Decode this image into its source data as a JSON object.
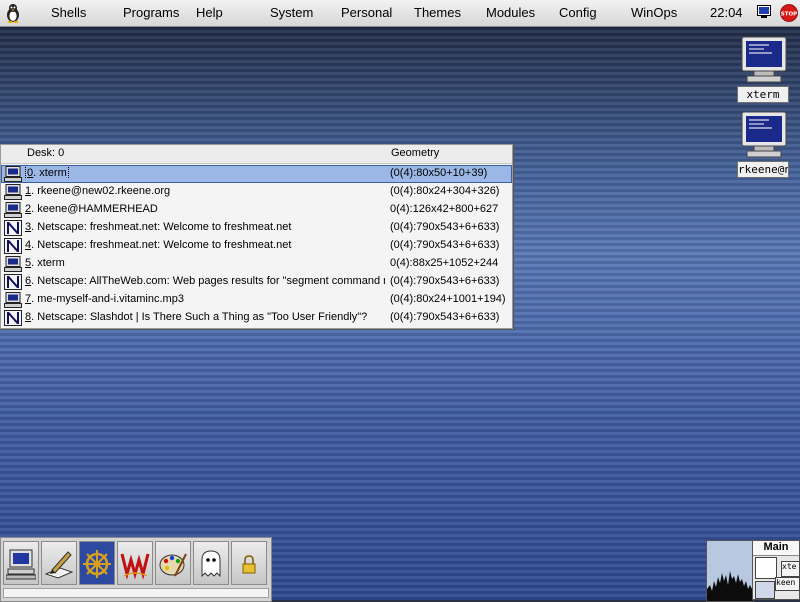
{
  "menubar": {
    "items": [
      "Shells",
      "Programs",
      "Help",
      "System",
      "Personal",
      "Themes",
      "Modules",
      "Config",
      "WinOps"
    ],
    "clock": "22:04",
    "stop_label": "STOP"
  },
  "desktop_icons": [
    {
      "label": "xterm",
      "icon": "monitor-icon"
    },
    {
      "label": "rkeene@n",
      "icon": "monitor-icon"
    }
  ],
  "window_list": {
    "header_desk": "Desk: 0",
    "header_geometry": "Geometry",
    "rows": [
      {
        "num": "0",
        "title": "xterm",
        "geometry": "(0(4):80x50+10+39)",
        "icon": "terminal-icon",
        "selected": true
      },
      {
        "num": "1",
        "title": "rkeene@new02.rkeene.org",
        "geometry": "(0(4):80x24+304+326)",
        "icon": "terminal-icon"
      },
      {
        "num": "2",
        "title": "keene@HAMMERHEAD",
        "geometry": "0(4):126x42+800+627",
        "icon": "terminal-icon"
      },
      {
        "num": "3",
        "title": "Netscape: freshmeat.net: Welcome to freshmeat.net",
        "geometry": "(0(4):790x543+6+633)",
        "icon": "netscape-icon"
      },
      {
        "num": "4",
        "title": "Netscape: freshmeat.net: Welcome to freshmeat.net",
        "geometry": "(0(4):790x543+6+633)",
        "icon": "netscape-icon"
      },
      {
        "num": "5",
        "title": "xterm",
        "geometry": "0(4):88x25+1052+244",
        "icon": "terminal-icon"
      },
      {
        "num": "6",
        "title": "Netscape: AllTheWeb.com: Web pages results for \"segment command maps\"",
        "geometry": "(0(4):790x543+6+633)",
        "icon": "netscape-icon"
      },
      {
        "num": "7",
        "title": "me-myself-and-i.vitaminc.mp3",
        "geometry": "(0(4):80x24+1001+194)",
        "icon": "terminal-icon"
      },
      {
        "num": "8",
        "title": "Netscape: Slashdot | Is There Such a Thing as \"Too User Friendly\"?",
        "geometry": "(0(4):790x543+6+633)",
        "icon": "netscape-icon"
      }
    ]
  },
  "dock": {
    "buttons": [
      "computer-icon",
      "editor-pen-icon",
      "ship-wheel-icon",
      "wine-w-icon",
      "paint-palette-icon",
      "ghost-icon",
      "lock-icon"
    ]
  },
  "pager": {
    "title": "Main",
    "windows": [
      "xte",
      "keen"
    ]
  }
}
